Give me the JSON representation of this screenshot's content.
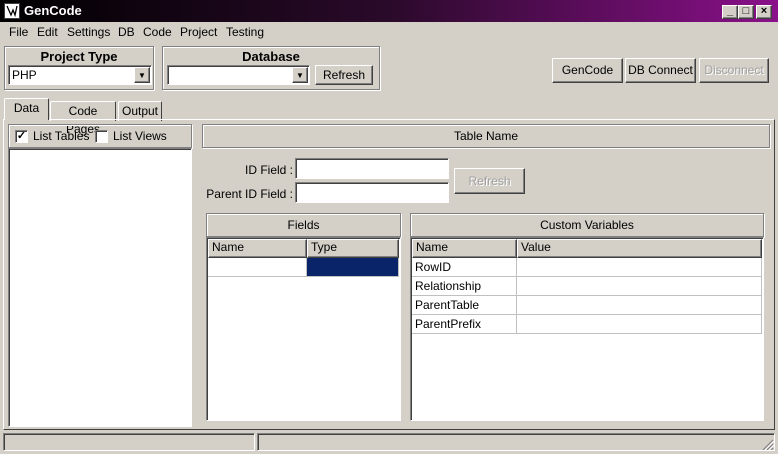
{
  "window": {
    "title": "GenCode",
    "controls": {
      "minimize": "_",
      "maximize": "□",
      "close": "×"
    }
  },
  "menu": [
    "File",
    "Edit",
    "Settings",
    "DB",
    "Code",
    "Project",
    "Testing"
  ],
  "project_type": {
    "title": "Project Type",
    "value": "PHP"
  },
  "database": {
    "title": "Database",
    "value": "",
    "refresh_label": "Refresh"
  },
  "toolbar": {
    "gencode": "GenCode",
    "db_connect": "DB Connect",
    "disconnect": "Disconnect"
  },
  "tabs": [
    {
      "label": "Data",
      "active": true
    },
    {
      "label": "Code Pages",
      "active": false
    },
    {
      "label": "Output",
      "active": false
    }
  ],
  "left_panel": {
    "list_tables": {
      "label": "List Tables",
      "checked": true
    },
    "list_views": {
      "label": "List Views",
      "checked": false
    }
  },
  "table_name_header": "Table Name",
  "id_field": {
    "label": "ID Field :",
    "value": ""
  },
  "parent_id_field": {
    "label": "Parent ID Field :",
    "value": ""
  },
  "refresh_disabled_label": "Refresh",
  "fields_panel": {
    "title": "Fields",
    "columns": [
      "Name",
      "Type"
    ]
  },
  "custom_vars_panel": {
    "title": "Custom Variables",
    "columns": [
      "Name",
      "Value"
    ],
    "rows": [
      {
        "name": "RowID",
        "value": ""
      },
      {
        "name": "Relationship",
        "value": ""
      },
      {
        "name": "ParentTable",
        "value": ""
      },
      {
        "name": "ParentPrefix",
        "value": ""
      }
    ]
  },
  "colors": {
    "face": "#d4d0c8",
    "selection": "#0a246a",
    "title_gradient_end": "#8a108a"
  }
}
